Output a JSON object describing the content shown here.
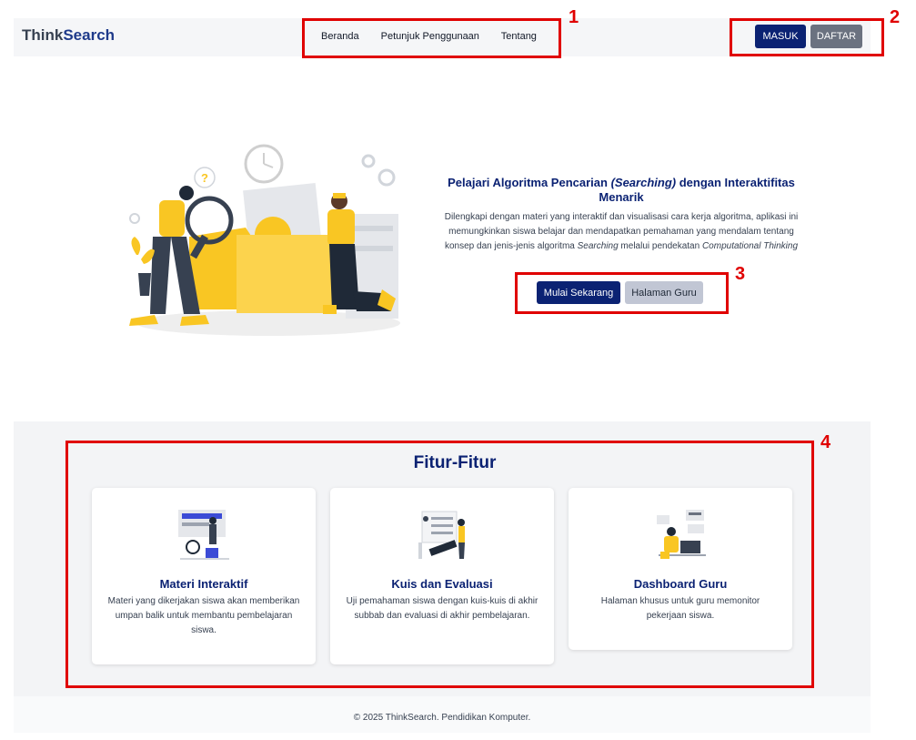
{
  "navbar": {
    "brand_prefix": "Think",
    "brand_suffix": "Search",
    "links": [
      "Beranda",
      "Petunjuk Penggunaan",
      "Tentang"
    ],
    "login_label": "MASUK",
    "register_label": "DAFTAR"
  },
  "hero": {
    "title_part1": "Pelajari Algoritma Pencarian ",
    "title_italic": "(Searching)",
    "title_part2": " dengan Interaktifitas Menarik",
    "desc_part1": "Dilengkapi dengan materi yang interaktif dan visualisasi cara kerja algoritma, aplikasi ini memungkinkan siswa belajar dan mendapatkan pemahaman yang mendalam tentang konsep dan jenis-jenis algoritma ",
    "desc_italic1": "Searching",
    "desc_part2": " melalui pendekatan ",
    "desc_italic2": "Computational Thinking",
    "start_label": "Mulai Sekarang",
    "teacher_label": "Halaman Guru"
  },
  "features": {
    "title": "Fitur-Fitur",
    "cards": [
      {
        "title": "Materi Interaktif",
        "desc": "Materi yang dikerjakan siswa akan memberikan umpan balik untuk membantu pembelajaran siswa."
      },
      {
        "title": "Kuis dan Evaluasi",
        "desc": "Uji pemahaman siswa dengan kuis-kuis di akhir subbab dan evaluasi di akhir pembelajaran."
      },
      {
        "title": "Dashboard Guru",
        "desc": "Halaman khusus untuk guru memonitor pekerjaan siswa."
      }
    ]
  },
  "footer": {
    "text": "© 2025 ThinkSearch. Pendidikan Komputer."
  },
  "annotations": [
    "1",
    "2",
    "3",
    "4"
  ],
  "colors": {
    "primary": "#0b2273",
    "annotation": "#e00000",
    "accent_yellow": "#f9c623"
  }
}
